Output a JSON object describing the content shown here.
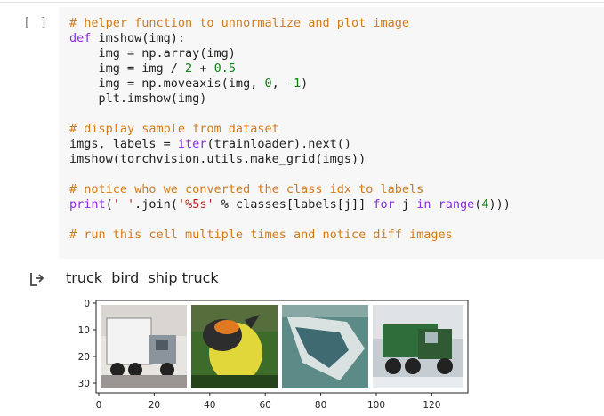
{
  "cell": {
    "run_indicator": "[ ]",
    "code_lines": [
      [
        {
          "t": "# helper function to unnormalize and plot image",
          "c": "c"
        }
      ],
      [
        {
          "t": "def ",
          "c": "k"
        },
        {
          "t": "imshow(img):",
          "c": "p"
        }
      ],
      [
        {
          "t": "    img = np.array(img)",
          "c": "p"
        }
      ],
      [
        {
          "t": "    img = img / ",
          "c": "p"
        },
        {
          "t": "2",
          "c": "n"
        },
        {
          "t": " + ",
          "c": "p"
        },
        {
          "t": "0.5",
          "c": "n"
        }
      ],
      [
        {
          "t": "    img = np.moveaxis(img, ",
          "c": "p"
        },
        {
          "t": "0",
          "c": "n"
        },
        {
          "t": ", ",
          "c": "p"
        },
        {
          "t": "-1",
          "c": "n"
        },
        {
          "t": ")",
          "c": "p"
        }
      ],
      [
        {
          "t": "    plt.imshow(img)",
          "c": "p"
        }
      ],
      [],
      [
        {
          "t": "# display sample from dataset",
          "c": "c"
        }
      ],
      [
        {
          "t": "imgs, labels = ",
          "c": "p"
        },
        {
          "t": "iter",
          "c": "k"
        },
        {
          "t": "(trainloader).next()",
          "c": "p"
        }
      ],
      [
        {
          "t": "imshow(torchvision.utils.make_grid(imgs))",
          "c": "p"
        }
      ],
      [],
      [
        {
          "t": "# notice who we converted the class idx to labels",
          "c": "c"
        }
      ],
      [
        {
          "t": "print",
          "c": "k"
        },
        {
          "t": "(",
          "c": "p"
        },
        {
          "t": "' '",
          "c": "s"
        },
        {
          "t": ".join(",
          "c": "p"
        },
        {
          "t": "'%5s'",
          "c": "s"
        },
        {
          "t": " % classes[labels[j]] ",
          "c": "p"
        },
        {
          "t": "for",
          "c": "k"
        },
        {
          "t": " j ",
          "c": "p"
        },
        {
          "t": "in",
          "c": "k"
        },
        {
          "t": " ",
          "c": "p"
        },
        {
          "t": "range",
          "c": "k"
        },
        {
          "t": "(",
          "c": "p"
        },
        {
          "t": "4",
          "c": "n"
        },
        {
          "t": ")))",
          "c": "p"
        }
      ],
      [],
      [
        {
          "t": "# run this cell multiple times and notice diff images",
          "c": "c"
        }
      ]
    ]
  },
  "output": {
    "icon": "output-arrow-icon",
    "text": "truck  bird  ship truck",
    "image_labels": [
      "truck",
      "bird",
      "ship",
      "truck"
    ],
    "y_ticks": [
      "0",
      "10",
      "20",
      "30"
    ],
    "x_ticks": [
      "0",
      "20",
      "40",
      "60",
      "80",
      "100",
      "120"
    ]
  },
  "colors": {
    "comment": "#d27b1b",
    "keyword": "#8a2be2",
    "number": "#0f7f10",
    "string": "#b5221e",
    "cell_bg": "#f7f7f7"
  }
}
